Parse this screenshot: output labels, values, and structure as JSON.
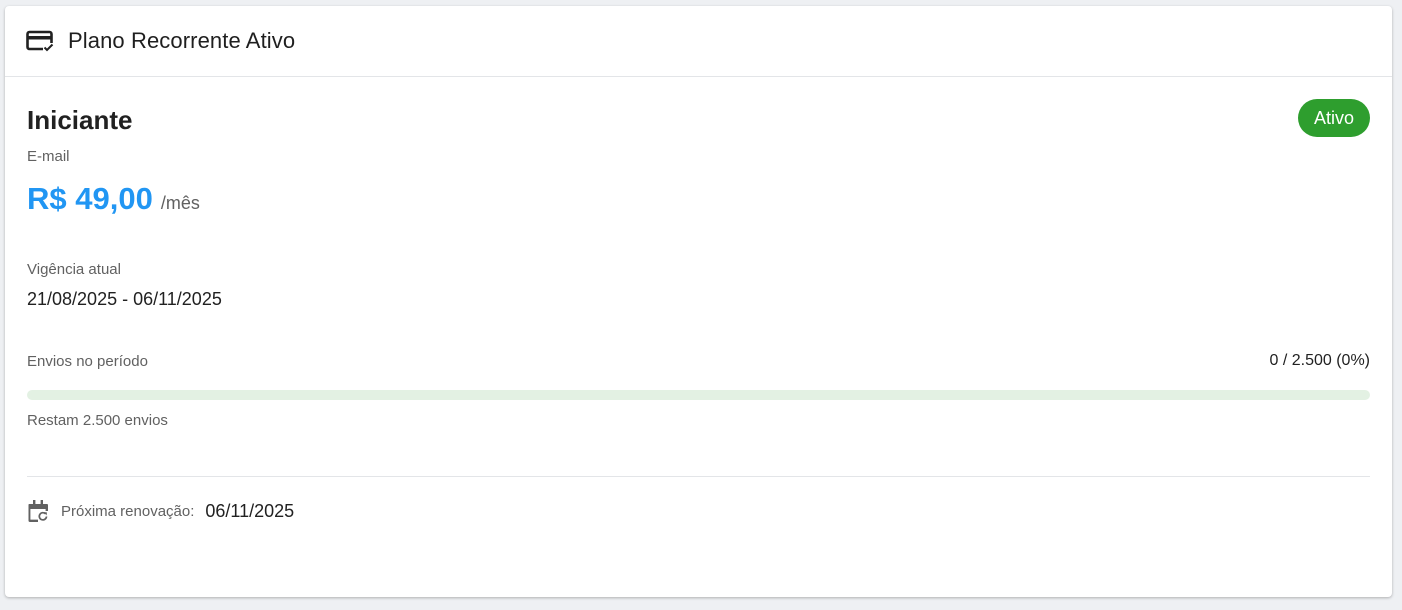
{
  "header": {
    "icon": "credit-card-check-icon",
    "title": "Plano Recorrente Ativo"
  },
  "plan": {
    "name": "Iniciante",
    "channel": "E-mail",
    "status": "Ativo",
    "status_color": "#2e9e2e",
    "price": "R$ 49,00",
    "price_color": "#2196f3",
    "period": "/mês"
  },
  "vigencia": {
    "label": "Vigência atual",
    "value": "21/08/2025 - 06/11/2025"
  },
  "envios": {
    "label": "Envios no período",
    "count_text": "0 / 2.500 (0%)",
    "progress_fraction": 0,
    "track_color": "#e3f1e3",
    "remaining_text": "Restam 2.500 envios"
  },
  "renewal": {
    "icon": "calendar-refresh-icon",
    "label": "Próxima renovação:",
    "value": "06/11/2025"
  }
}
